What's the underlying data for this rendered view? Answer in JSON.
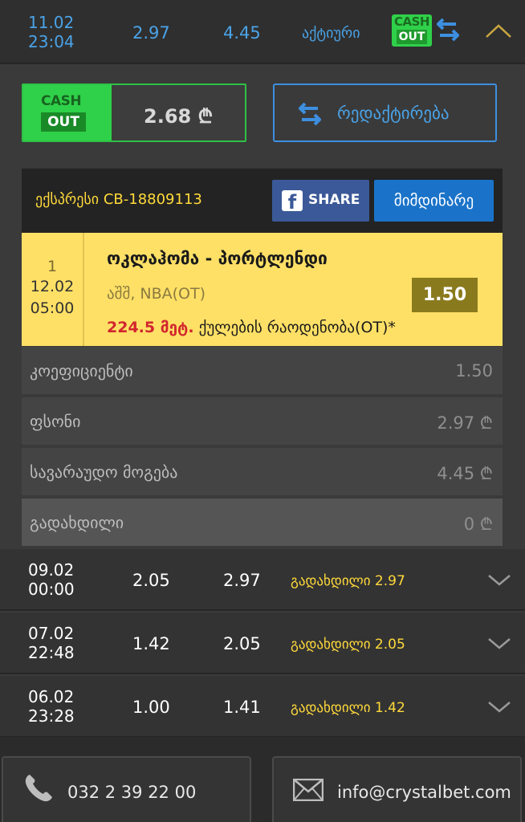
{
  "header": {
    "date": "11.02",
    "time": "23:04",
    "stake": "2.97",
    "possible_win": "4.45",
    "status": "აქტიური",
    "cash_label": "CASH",
    "out_label": "OUT"
  },
  "cashout": {
    "cash_label": "CASH",
    "out_label": "OUT",
    "amount": "2.68 ₾"
  },
  "edit_label": "რედაქტირება",
  "ticket": {
    "label": "ექსპრესი  CB-18809113",
    "share_label": "SHARE",
    "current_label": "მიმდინარე"
  },
  "event": {
    "number": "1",
    "date": "12.02",
    "time": "05:00",
    "title": "ოკლაჰომა - პორტლენდი",
    "league": "აშშ, NBA(OT)",
    "odds": "1.50",
    "market_value": "224.5 მეტ.",
    "market_name": " ქულების რაოდენობა(OT)*"
  },
  "details": [
    {
      "label": "კოეფიციენტი",
      "value": "1.50"
    },
    {
      "label": "ფსონი",
      "value": "2.97 ₾"
    },
    {
      "label": "სავარაუდო მოგება",
      "value": "4.45 ₾"
    },
    {
      "label": "გადახდილი",
      "value": "0 ₾"
    }
  ],
  "history": [
    {
      "date": "09.02",
      "time": "00:00",
      "a": "2.05",
      "b": "2.97",
      "status": "გადახდილი  2.97"
    },
    {
      "date": "07.02",
      "time": "22:48",
      "a": "1.42",
      "b": "2.05",
      "status": "გადახდილი  2.05"
    },
    {
      "date": "06.02",
      "time": "23:28",
      "a": "1.00",
      "b": "1.41",
      "status": "გადახდილი  1.42"
    }
  ],
  "footer": {
    "phone": "032 2 39 22 00",
    "email": "info@crystalbet.com"
  }
}
